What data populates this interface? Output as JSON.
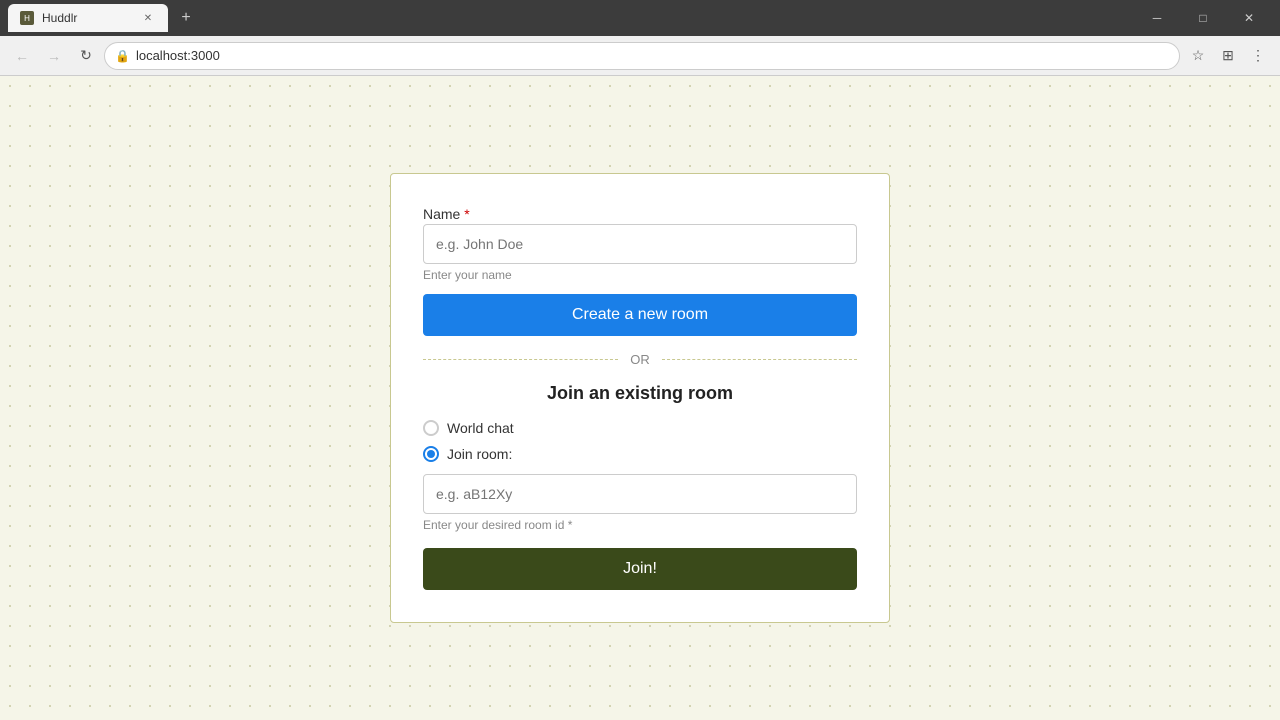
{
  "browser": {
    "tab_title": "Huddlr",
    "tab_favicon": "H",
    "new_tab_label": "+",
    "address": "localhost:3000",
    "window_controls": {
      "minimize": "─",
      "maximize": "□",
      "close": "✕"
    },
    "nav": {
      "back": "←",
      "forward": "→",
      "reload": "↻",
      "lock_icon": "🔒"
    },
    "toolbar_icons": {
      "star": "☆",
      "extensions": "⊞",
      "menu": "⋮"
    }
  },
  "form": {
    "name_label": "Name",
    "name_required": "*",
    "name_placeholder": "e.g. John Doe",
    "name_hint": "Enter your name",
    "create_button": "Create a new room",
    "or_text": "OR",
    "join_title": "Join an existing room",
    "radio_world_chat": "World chat",
    "radio_join_room": "Join room:",
    "room_id_placeholder": "e.g. aB12Xy",
    "room_id_hint": "Enter your desired room id *",
    "join_button": "Join!"
  }
}
